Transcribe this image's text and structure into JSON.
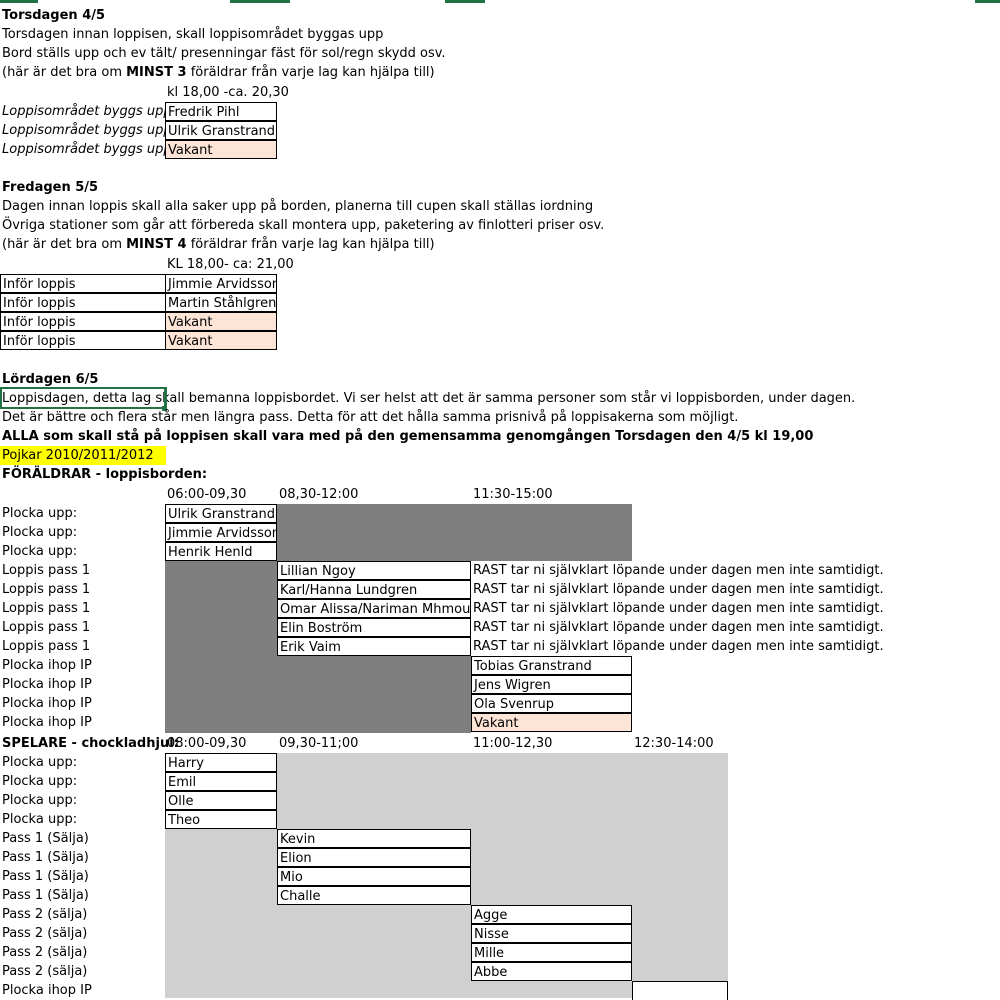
{
  "colors": {
    "vacant_fill": "#fce4d6",
    "highlight_fill": "#ffff00",
    "dark_block": "#7f7f7f",
    "light_block": "#d0d0d0",
    "selection": "#217346"
  },
  "thu": {
    "header": "Torsdagen  4/5",
    "lines": [
      "Torsdagen innan loppisen, skall loppisområdet byggas upp",
      "Bord ställs upp och ev tält/ presenningar fäst för sol/regn skydd osv."
    ],
    "note_pre": "(här är det bra om ",
    "note_bold": "MINST 3",
    "note_post": " föräldrar från varje lag kan hjälpa till)",
    "time": "kl 18,00 -ca. 20,30",
    "rows": [
      {
        "task": "Loppisområdet byggs upp",
        "name": "Fredrik Pihl"
      },
      {
        "task": "Loppisområdet byggs upp",
        "name": "Ulrik Granstrand"
      },
      {
        "task": "Loppisområdet byggs upp",
        "name": "Vakant"
      }
    ]
  },
  "fri": {
    "header": "Fredagen 5/5",
    "lines": [
      "Dagen innan loppis skall alla saker upp på borden, planerna till cupen skall ställas iordning",
      "Övriga stationer som går att förbereda skall montera upp, paketering av finlotteri priser osv."
    ],
    "note_pre": "(här är det bra om ",
    "note_bold": "MINST 4",
    "note_post": "  föräldrar från varje lag kan hjälpa till)",
    "time": "KL 18,00- ca: 21,00",
    "rows": [
      {
        "task": "Inför loppis",
        "name": "Jimmie Arvidsson"
      },
      {
        "task": "Inför loppis",
        "name": "Martin Ståhlgren"
      },
      {
        "task": "Inför loppis",
        "name": "Vakant"
      },
      {
        "task": "Inför loppis",
        "name": "Vakant"
      }
    ]
  },
  "sat": {
    "header": "Lördagen 6/5",
    "lines": [
      "Loppisdagen, detta lag skall bemanna loppisbordet. Vi ser helst att det är samma personer som står vi loppisborden, under dagen.",
      "Det är bättre och flera står men längra pass. Detta för att det hålla samma prisnivå på loppisakerna som möjligt."
    ],
    "bold_line": "ALLA som skall stå på loppisen skall vara med på den gemensamma genomgången Torsdagen den 4/5 kl 19,00",
    "team": "Pojkar 2010/2011/2012"
  },
  "parents": {
    "label": "FÖRÄLDRAR - loppisborden:",
    "times": [
      "06:00-09,30",
      "08,30-12:00",
      "11:30-15:00"
    ],
    "pickup": [
      {
        "task": "Plocka upp:",
        "name": "Ulrik Granstrand"
      },
      {
        "task": "Plocka upp:",
        "name": "Jimmie Arvidsson"
      },
      {
        "task": "Plocka upp:",
        "name": "Henrik Henld"
      }
    ],
    "pass1": [
      {
        "task": "Loppis pass 1",
        "name": "Lillian Ngoy",
        "note": "RAST tar ni självklart löpande under dagen men inte samtidigt."
      },
      {
        "task": "Loppis pass 1",
        "name": "Karl/Hanna Lundgren",
        "note": "RAST tar ni självklart löpande under dagen men inte samtidigt."
      },
      {
        "task": "Loppis pass 1",
        "name": "Omar Alissa/Nariman Mhmoud",
        "note": "RAST tar ni självklart löpande under dagen men inte samtidigt."
      },
      {
        "task": "Loppis pass 1",
        "name": "Elin Boström",
        "note": "RAST tar ni självklart löpande under dagen men inte samtidigt."
      },
      {
        "task": "Loppis pass 1",
        "name": "Erik Vaim",
        "note": "RAST tar ni självklart löpande under dagen men inte samtidigt."
      }
    ],
    "packup": [
      {
        "task": "Plocka ihop IP",
        "name": "Tobias Granstrand"
      },
      {
        "task": "Plocka ihop IP",
        "name": "Jens Wigren"
      },
      {
        "task": "Plocka ihop IP",
        "name": "Ola Svenrup"
      },
      {
        "task": "Plocka ihop IP",
        "name": "Vakant"
      }
    ]
  },
  "players": {
    "label": "SPELARE - chockladhjul:",
    "times": [
      "08:00-09,30",
      "09,30-11;00",
      "11:00-12,30",
      "12:30-14:00"
    ],
    "pickup": [
      {
        "task": "Plocka upp:",
        "name": "Harry"
      },
      {
        "task": "Plocka upp:",
        "name": "Emil"
      },
      {
        "task": "Plocka upp:",
        "name": "Olle"
      },
      {
        "task": "Plocka upp:",
        "name": "Theo"
      }
    ],
    "pass1": [
      {
        "task": "Pass 1 (Sälja)",
        "name": "Kevin"
      },
      {
        "task": "Pass 1 (Sälja)",
        "name": "Elion"
      },
      {
        "task": "Pass 1 (Sälja)",
        "name": "Mio"
      },
      {
        "task": "Pass 1 (Sälja)",
        "name": "Challe"
      }
    ],
    "pass2": [
      {
        "task": "Pass 2 (sälja)",
        "name": "Agge"
      },
      {
        "task": "Pass 2 (sälja)",
        "name": "Nisse"
      },
      {
        "task": "Pass 2 (sälja)",
        "name": "Mille"
      },
      {
        "task": "Pass 2 (sälja)",
        "name": "Abbe"
      }
    ],
    "last_task": "Plocka ihop IP"
  }
}
